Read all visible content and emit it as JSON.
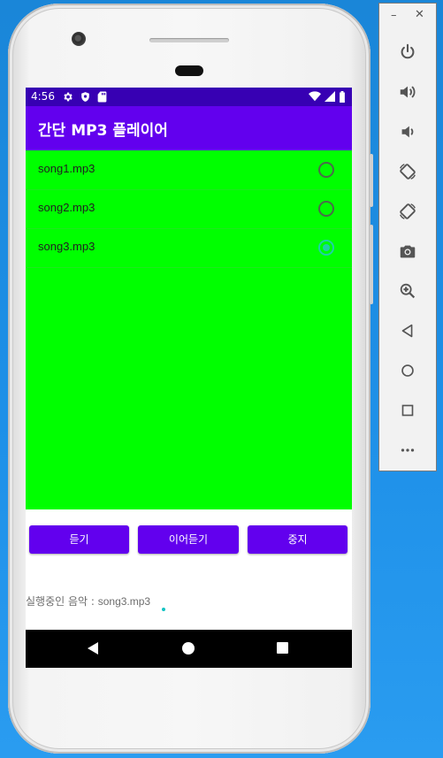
{
  "status_bar": {
    "time": "4:56",
    "left_icons": [
      "settings-icon",
      "shield-icon",
      "sd-card-icon"
    ],
    "right_icons": [
      "wifi-icon",
      "signal-icon",
      "battery-icon"
    ]
  },
  "app_bar": {
    "title": "간단 MP3 플레이어"
  },
  "song_list": {
    "background": "#00ff00",
    "items": [
      {
        "label": "song1.mp3",
        "selected": false
      },
      {
        "label": "song2.mp3",
        "selected": false
      },
      {
        "label": "song3.mp3",
        "selected": true
      }
    ]
  },
  "buttons": {
    "play": "듣기",
    "resume": "이어듣기",
    "stop": "중지"
  },
  "now_playing": {
    "label": "실행중인 음악 : ",
    "value": "song3.mp3"
  },
  "emulator_toolbar": {
    "window_controls": [
      "minimize-icon",
      "close-icon"
    ],
    "items": [
      "power-icon",
      "volume-up-icon",
      "volume-down-icon",
      "rotate-left-icon",
      "rotate-right-icon",
      "camera-icon",
      "zoom-icon",
      "back-icon",
      "home-icon",
      "overview-icon",
      "more-icon"
    ]
  },
  "colors": {
    "primary": "#6200ee",
    "primary_dark": "#3700b3",
    "list_bg": "#00ff00",
    "radio_checked": "#1fd0a8"
  }
}
